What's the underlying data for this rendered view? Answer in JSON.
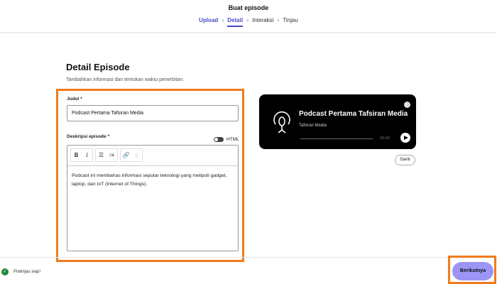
{
  "header": {
    "title": "Buat episode",
    "steps": [
      "Upload",
      "Detail",
      "Interaksi",
      "Tinjau"
    ],
    "active_step": "Detail"
  },
  "main": {
    "heading": "Detail Episode",
    "subtitle": "Tambahkan informasi dan tentukan waktu penerbitan.",
    "title_label": "Judul *",
    "title_value": "Podcast Pertama Tafsiran Media",
    "desc_label": "Deskripsi episode *",
    "html_toggle_label": "HTML",
    "html_toggle_on": false,
    "toolbar": {
      "bold": "B",
      "italic": "I"
    },
    "desc_value": "Podcast ini membahas informasi seputar teknologi yang meliputi gadget, laptop, dan IoT (Internet of Things)."
  },
  "preview": {
    "title": "Podcast Pertama Tafsiran Media",
    "author": "Tafsiran Media",
    "time": "00:00",
    "change_label": "Ganti"
  },
  "footer": {
    "status": "Pratinjau siap!",
    "next_label": "Berikutnya"
  },
  "colors": {
    "accent": "#4a4ac8",
    "button": "#9d95f5",
    "highlight": "#f07c1e"
  }
}
